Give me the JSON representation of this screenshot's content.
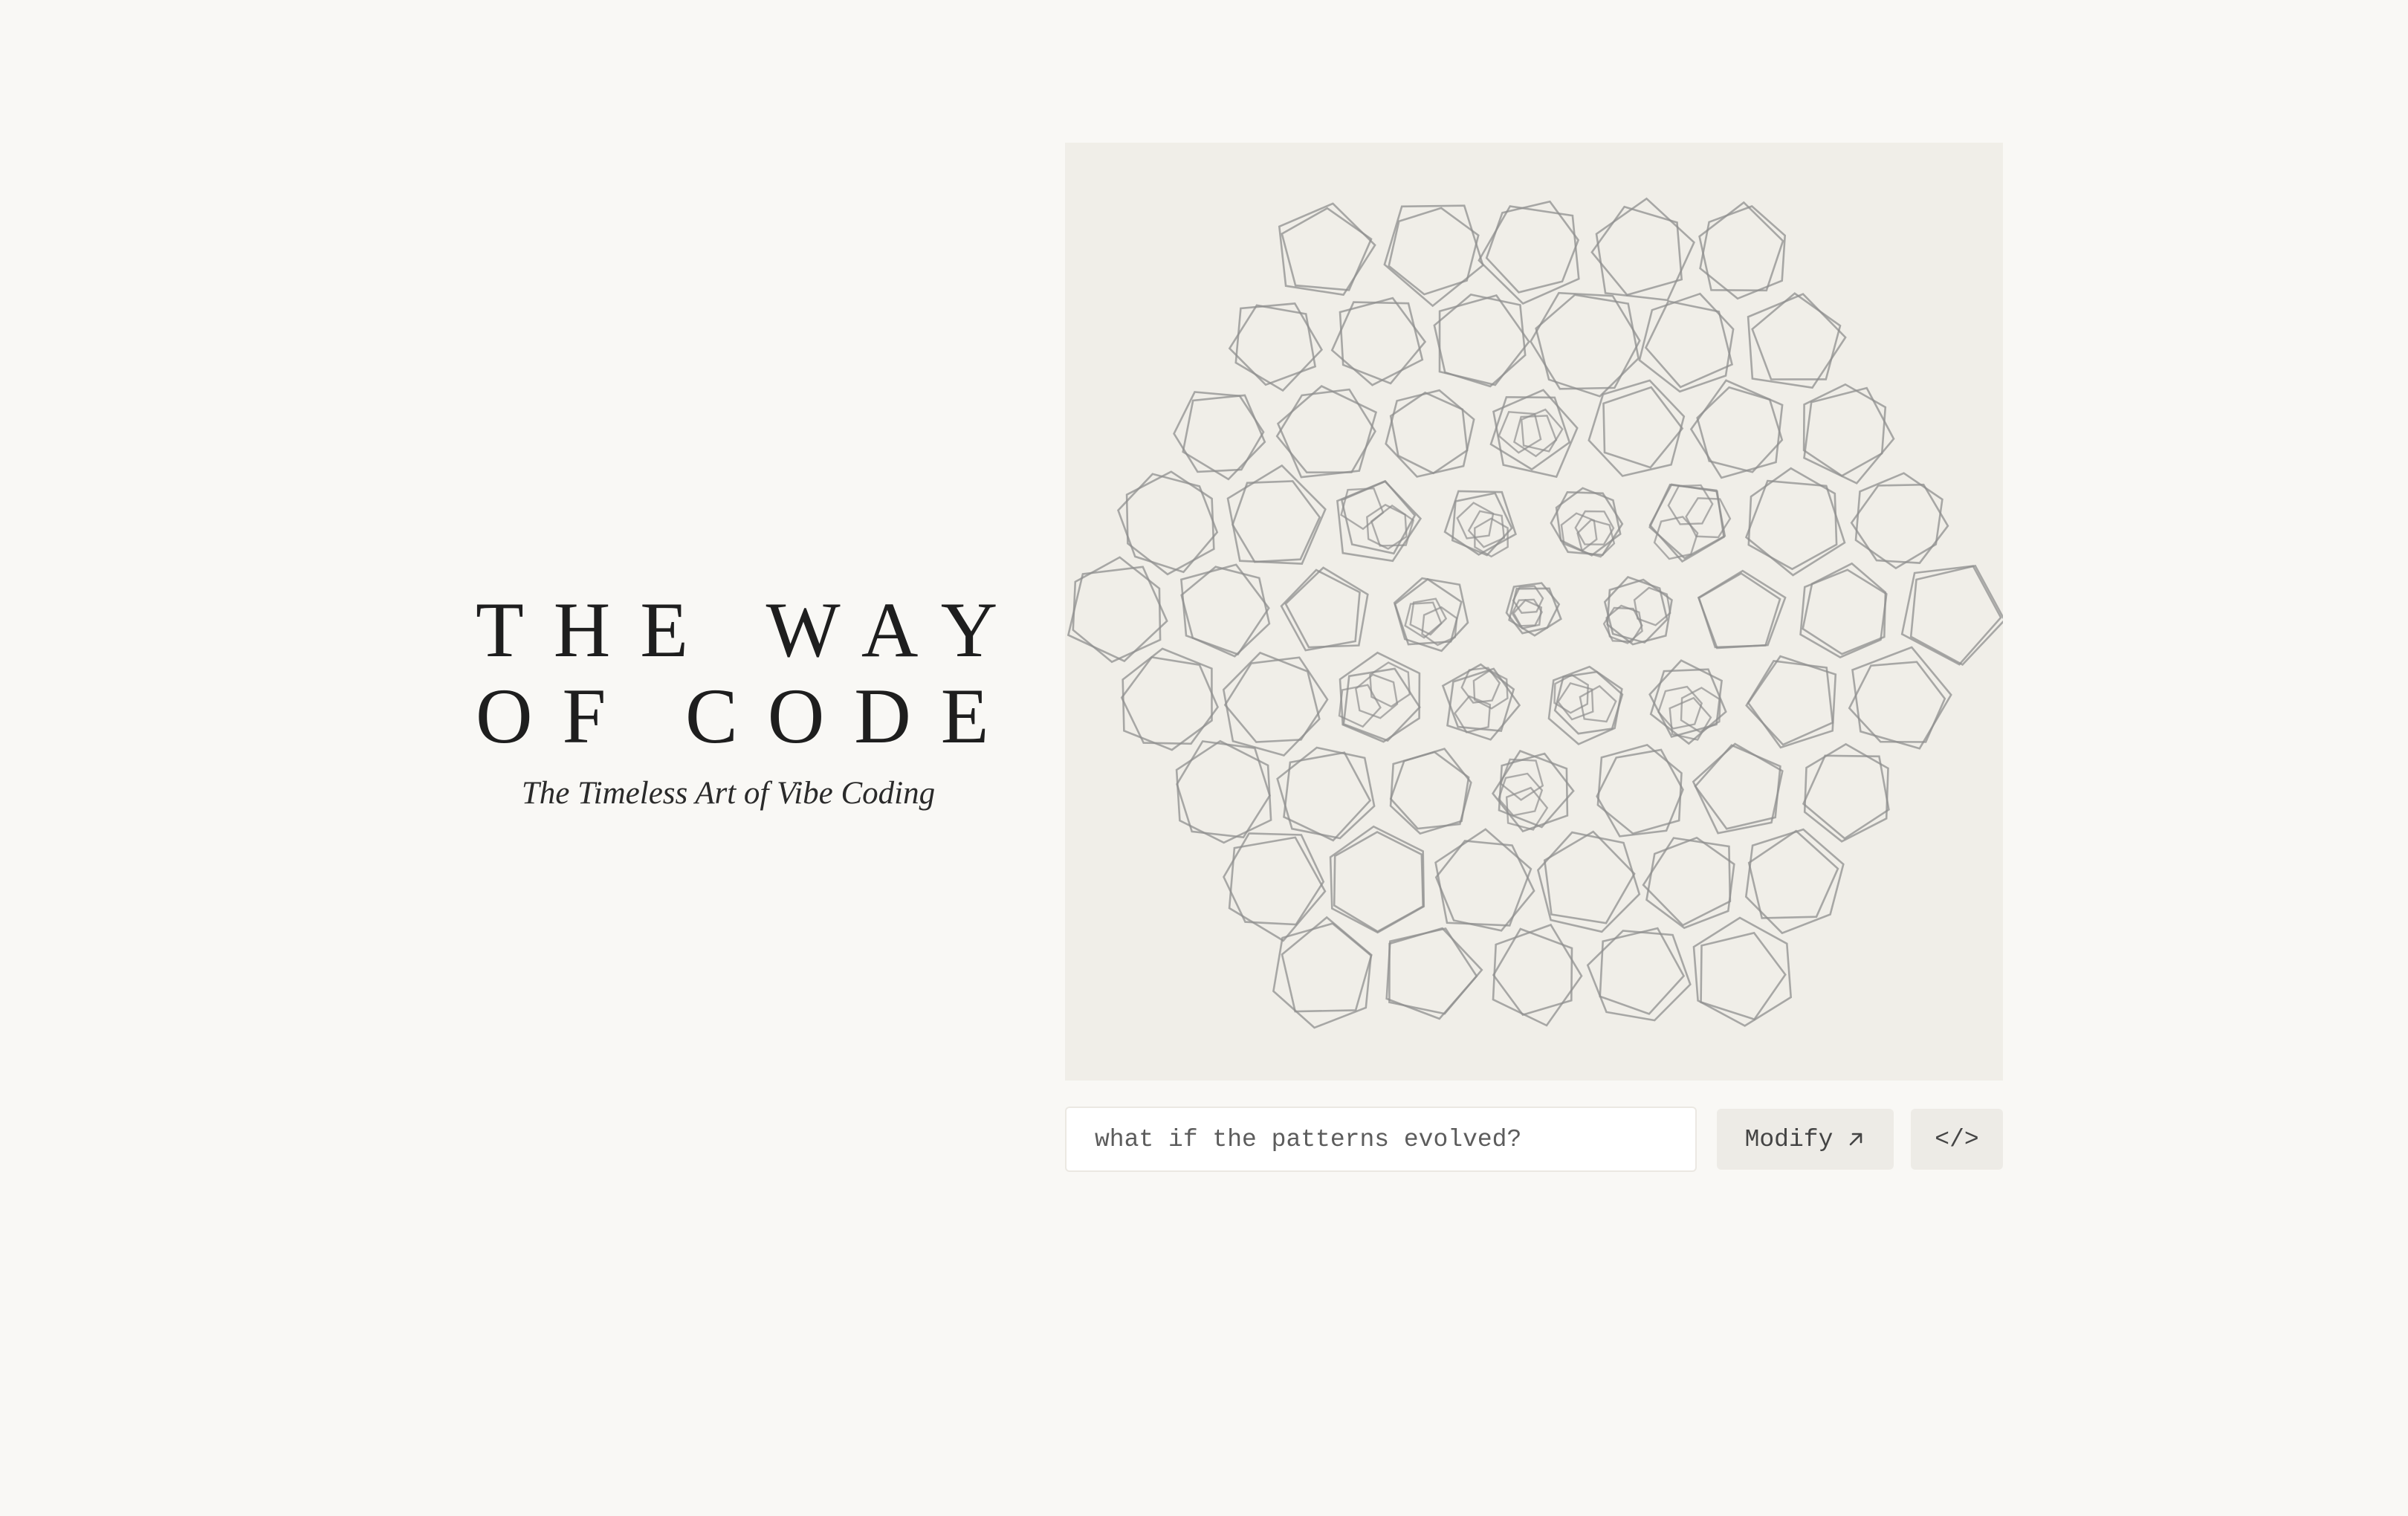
{
  "title": {
    "line1": "THE WAY",
    "line2": "OF CODE",
    "subtitle": "The Timeless Art of Vibe Coding"
  },
  "artwork": {
    "description_icon": "polygon-pattern",
    "stroke_color": "#8f8f8f",
    "background_color": "#f0eee8"
  },
  "prompt": {
    "placeholder": "what if the patterns evolved?",
    "value": ""
  },
  "actions": {
    "modify_label": "Modify",
    "modify_icon": "arrow-up-right-icon",
    "code_label": "</>",
    "code_icon": "code-icon"
  },
  "colors": {
    "page_background": "#f9f8f5",
    "text": "#1e1e1e",
    "button_background": "#edebe6"
  }
}
